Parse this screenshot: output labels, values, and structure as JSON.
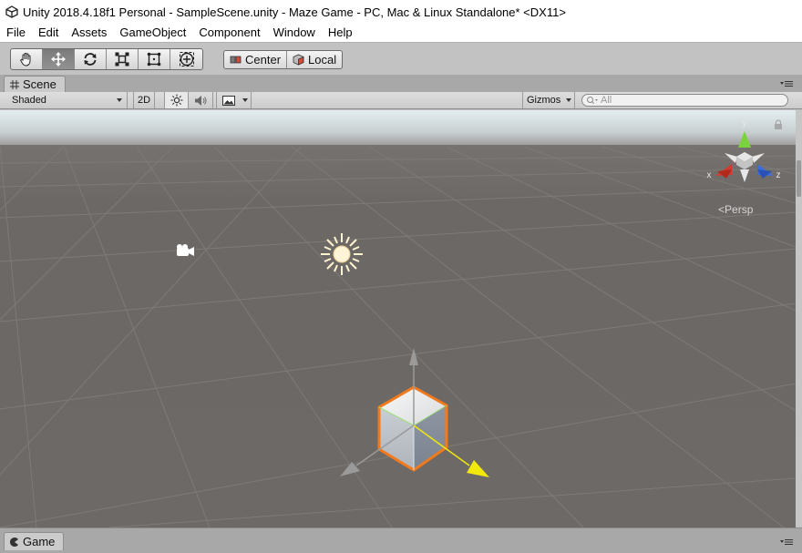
{
  "window": {
    "title": "Unity 2018.4.18f1 Personal - SampleScene.unity - Maze Game - PC, Mac & Linux Standalone* <DX11>"
  },
  "menu": {
    "items": [
      "File",
      "Edit",
      "Assets",
      "GameObject",
      "Component",
      "Window",
      "Help"
    ]
  },
  "toolbar": {
    "tools": [
      {
        "name": "hand-tool",
        "icon": "hand-icon",
        "active": false
      },
      {
        "name": "move-tool",
        "icon": "move-arrows-icon",
        "active": true
      },
      {
        "name": "rotate-tool",
        "icon": "rotate-icon",
        "active": false
      },
      {
        "name": "scale-tool",
        "icon": "scale-icon",
        "active": false
      },
      {
        "name": "rect-tool",
        "icon": "rect-transform-icon",
        "active": false
      },
      {
        "name": "transform-tool",
        "icon": "transform-icon",
        "active": false
      }
    ],
    "pivot_label": "Center",
    "rotation_label": "Local"
  },
  "scene_tab": {
    "label": "Scene",
    "icon": "hash-grid-icon"
  },
  "scene_toolbar": {
    "shading_mode": "Shaded",
    "mode_2d": "2D",
    "lighting_icon": "sun-icon",
    "audio_icon": "speaker-icon",
    "effects_icon": "image-icon",
    "gizmos_label": "Gizmos",
    "search_placeholder": "All"
  },
  "scene_view": {
    "projection_label": "Persp",
    "axis_labels": {
      "x": "x",
      "y": "y",
      "z": "z"
    },
    "colors": {
      "sky": "#dfe9ec",
      "ground": "#6c6866",
      "grid": "#7b7773",
      "selection_outline": "#f27a1c",
      "y_axis": "#7ad23c",
      "x_axis": "#d63a2a",
      "z_axis": "#3a6ee0",
      "move_x_arrow": "#f2e80c"
    }
  },
  "game_tab": {
    "label": "Game",
    "icon": "pacman-icon"
  }
}
